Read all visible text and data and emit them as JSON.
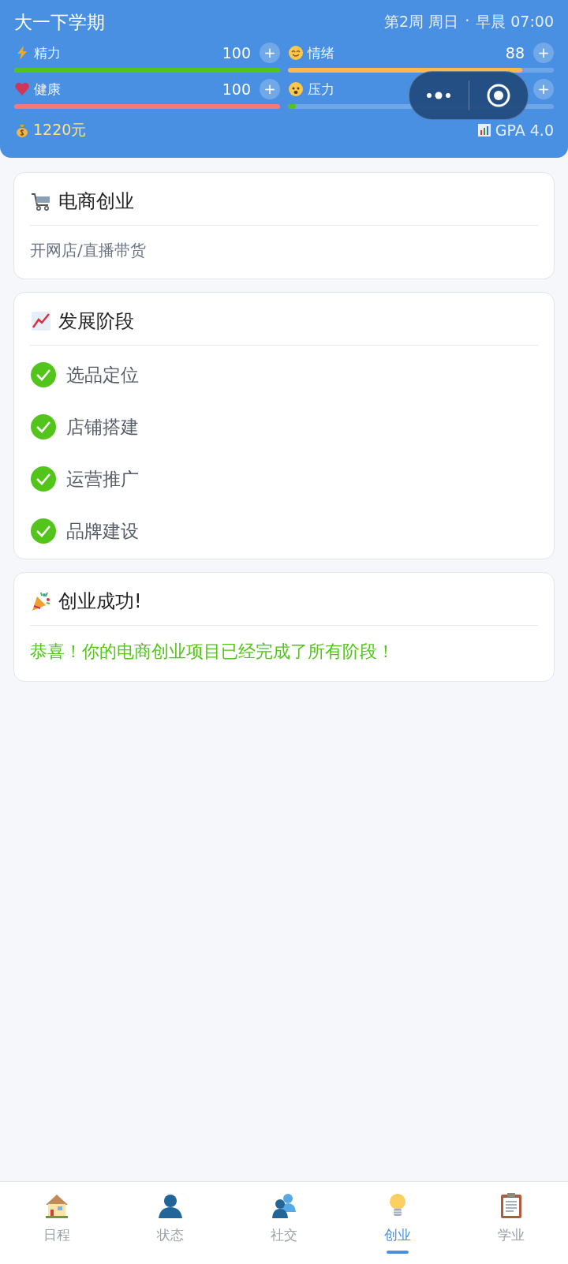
{
  "header": {
    "term": "大一下学期",
    "week": "第2周 周日",
    "dot": "·",
    "time": "早晨 07:00",
    "stats": [
      {
        "label": "精力",
        "value": "100",
        "plus": "+",
        "level": 1.0,
        "color": "#52c41a"
      },
      {
        "label": "情绪",
        "value": "88",
        "plus": "+",
        "level": 0.88,
        "color": "#ffb84d"
      },
      {
        "label": "健康",
        "value": "100",
        "plus": "+",
        "level": 1.0,
        "color": "#f47a7a"
      },
      {
        "label": "压力",
        "plus": "+",
        "level": 0.03,
        "color": "#52c41a"
      }
    ],
    "money": "1220元",
    "gpa": "GPA 4.0"
  },
  "project": {
    "title": "电商创业",
    "desc": "开网店/直播带货"
  },
  "stages": {
    "title": "发展阶段",
    "items": [
      {
        "label": "选品定位",
        "done": true
      },
      {
        "label": "店铺搭建",
        "done": true
      },
      {
        "label": "运营推广",
        "done": true
      },
      {
        "label": "品牌建设",
        "done": true
      }
    ]
  },
  "success": {
    "title": "创业成功!",
    "message": "恭喜！你的电商创业项目已经完成了所有阶段！"
  },
  "nav": [
    {
      "label": "日程",
      "selected": false
    },
    {
      "label": "状态",
      "selected": false
    },
    {
      "label": "社交",
      "selected": false
    },
    {
      "label": "创业",
      "selected": true
    },
    {
      "label": "学业",
      "selected": false
    }
  ]
}
